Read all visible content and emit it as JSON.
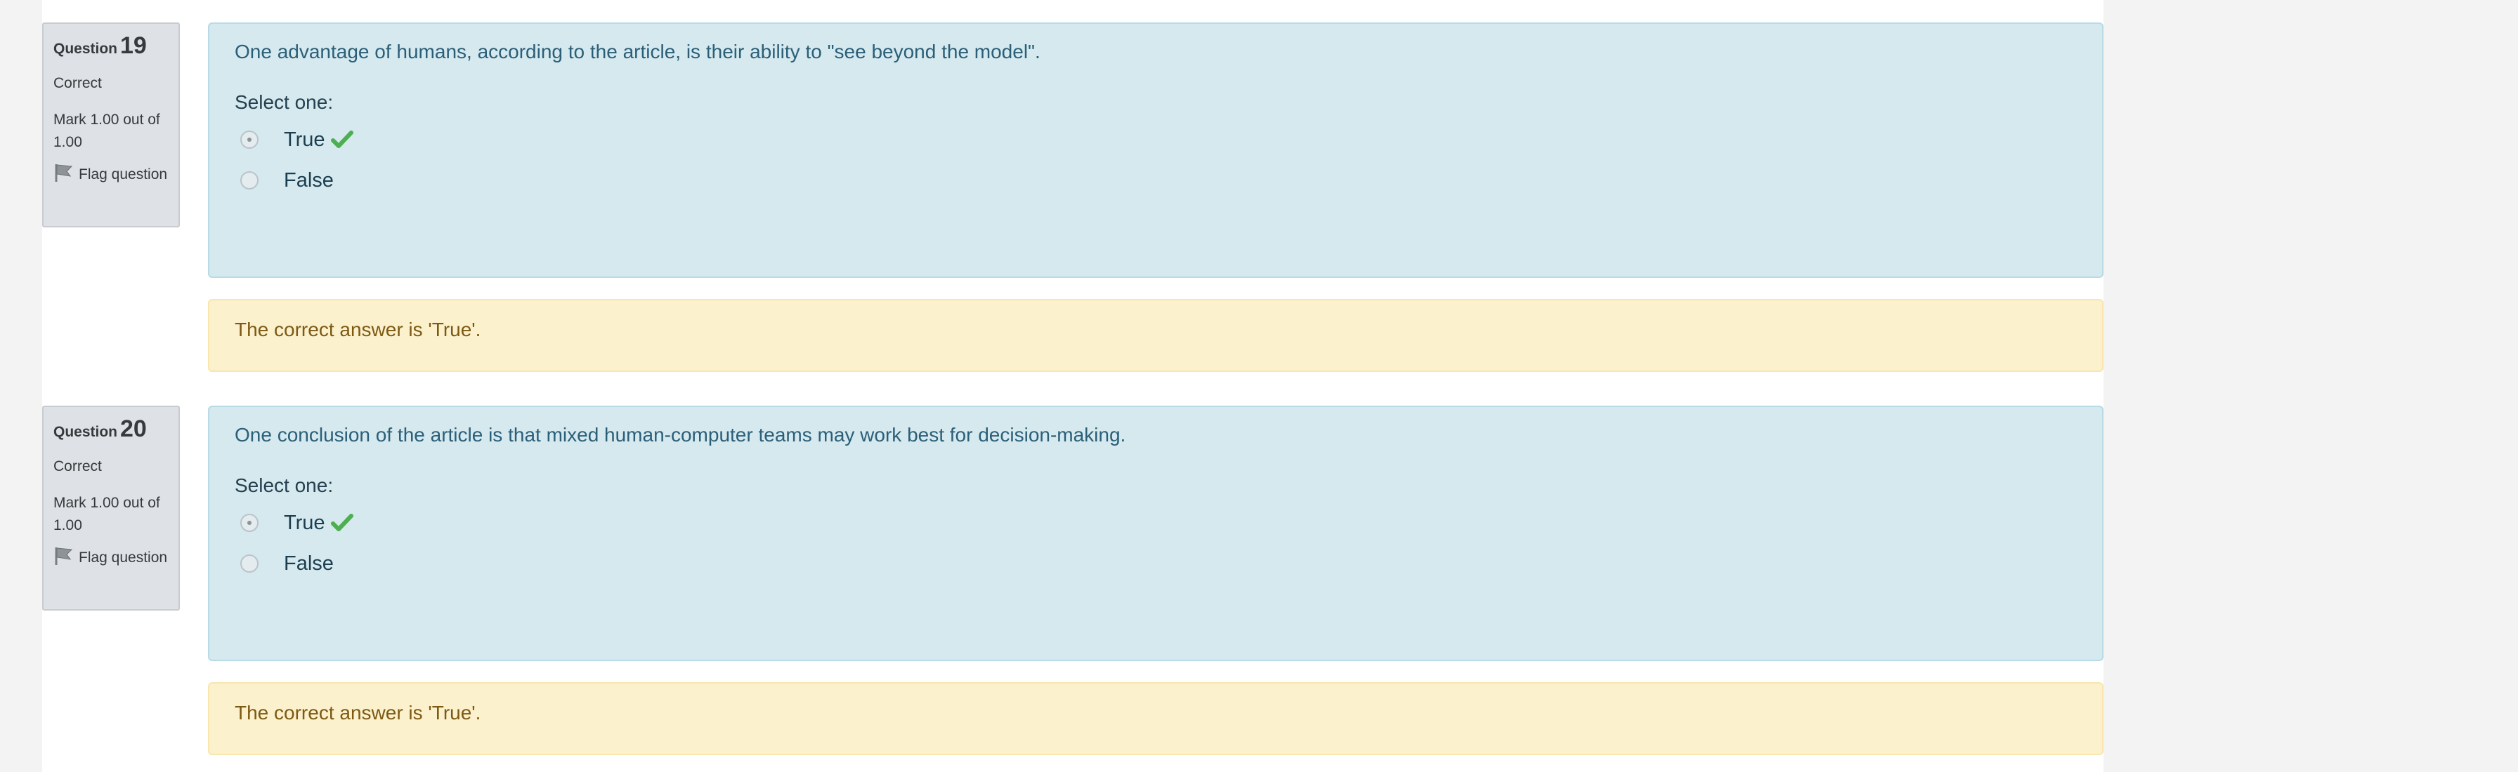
{
  "questions": [
    {
      "label": "Question",
      "number": "19",
      "state": "Correct",
      "grade": "Mark 1.00 out of 1.00",
      "flag_label": "Flag question",
      "text": "One advantage of humans, according to the article, is their ability to \"see beyond the model\".",
      "prompt": "Select one:",
      "options": [
        {
          "label": "True",
          "selected": true,
          "correct_icon": "check-icon"
        },
        {
          "label": "False",
          "selected": false
        }
      ],
      "right_answer": "The correct answer is 'True'."
    },
    {
      "label": "Question",
      "number": "20",
      "state": "Correct",
      "grade": "Mark 1.00 out of 1.00",
      "flag_label": "Flag question",
      "text": "One conclusion of the article is that mixed human-computer teams may work best for decision-making.",
      "prompt": "Select one:",
      "options": [
        {
          "label": "True",
          "selected": true,
          "correct_icon": "check-icon"
        },
        {
          "label": "False",
          "selected": false
        }
      ],
      "right_answer": "The correct answer is 'True'."
    }
  ],
  "colors": {
    "formulation_bg": "#d5e9ef",
    "outcome_bg": "#fcf1cd",
    "info_bg": "#dee2e6",
    "check": "#4caf50"
  }
}
